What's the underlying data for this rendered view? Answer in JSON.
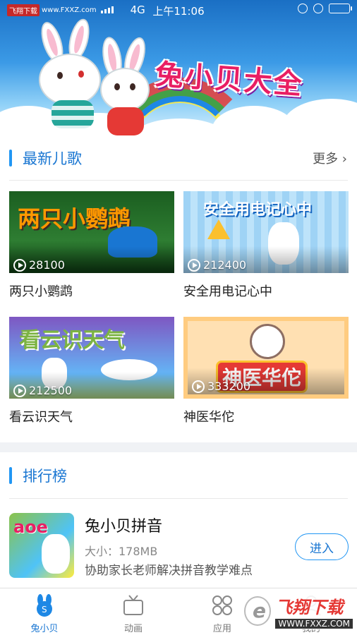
{
  "status_bar": {
    "watermark_badge": "飞翔下载",
    "watermark_url": "www.FXXZ.com",
    "network": "4G",
    "time": "上午11:06",
    "battery_level": 0.75
  },
  "banner": {
    "title": "兔小贝大全"
  },
  "latest": {
    "title": "最新儿歌",
    "more": "更多",
    "items": [
      {
        "title": "两只小鹦鹉",
        "plays": "28100",
        "thumb_text": "两只小鹦鹉",
        "bg": "#1b5e20"
      },
      {
        "title": "安全用电记心中",
        "plays": "212400",
        "thumb_text": "安全用电记心中",
        "bg": "#90caf9"
      },
      {
        "title": "看云识天气",
        "plays": "212500",
        "thumb_text": "看云识天气",
        "bg": "#7e57c2"
      },
      {
        "title": "神医华佗",
        "plays": "333200",
        "thumb_text": "神医华佗",
        "bg": "#ffe0b2"
      }
    ]
  },
  "ranking": {
    "title": "排行榜",
    "item": {
      "name": "兔小贝拼音",
      "size": "大小：178MB",
      "desc": "协助家长老师解决拼音教学难点",
      "button": "进入",
      "icon_letters": "aoe"
    }
  },
  "tabs": [
    {
      "label": "兔小贝",
      "icon": "bunny-icon",
      "active": true
    },
    {
      "label": "动画",
      "icon": "tv-icon",
      "active": false
    },
    {
      "label": "应用",
      "icon": "apps-icon",
      "active": false
    },
    {
      "label": "我的",
      "icon": "profile-icon",
      "active": false
    }
  ],
  "watermark": {
    "brand": "飞翔下载",
    "url": "WWW.FXXZ.COM"
  },
  "colors": {
    "accent": "#1976d2",
    "section_bar": "#2196f3"
  }
}
